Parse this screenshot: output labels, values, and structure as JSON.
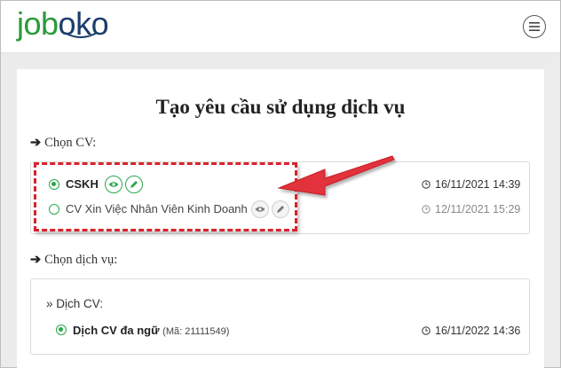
{
  "header": {
    "logo_part1": "job",
    "logo_part2": "oko",
    "menu_icon": "hamburger-icon"
  },
  "page": {
    "title": "Tạo yêu cầu sử dụng dịch vụ"
  },
  "cv_section": {
    "label": "Chọn CV:",
    "items": [
      {
        "name": "CSKH",
        "selected": true,
        "date": "16/11/2021 14:39"
      },
      {
        "name": "CV Xin Việc Nhân Viên Kinh Doanh",
        "selected": false,
        "date": "12/11/2021 15:29"
      }
    ]
  },
  "service_section": {
    "label": "Chọn dịch vụ:",
    "group_label": "Dịch CV:",
    "items": [
      {
        "name": "Dịch CV đa ngữ",
        "code": "(Mã: 21111549)",
        "selected": true,
        "date": "16/11/2022 14:36"
      }
    ]
  },
  "colors": {
    "accent_green": "#2aa84a",
    "highlight_red": "#d9232d",
    "logo_blue": "#1b3e6a"
  }
}
